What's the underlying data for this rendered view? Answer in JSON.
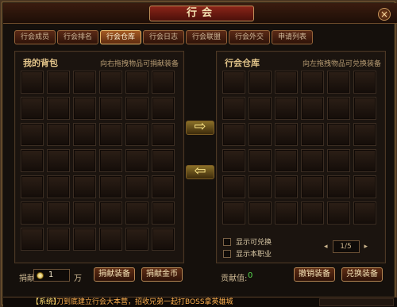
{
  "window": {
    "title": "行会",
    "close_icon": "close-icon"
  },
  "tabs": [
    {
      "label": "行会成员",
      "active": false
    },
    {
      "label": "行会排名",
      "active": false
    },
    {
      "label": "行会仓库",
      "active": true
    },
    {
      "label": "行会日志",
      "active": false
    },
    {
      "label": "行会联盟",
      "active": false
    },
    {
      "label": "行会外交",
      "active": false
    },
    {
      "label": "申请列表",
      "active": false
    }
  ],
  "left_panel": {
    "title": "我的背包",
    "hint": "向右拖拽物品可捐献装备"
  },
  "right_panel": {
    "title": "行会仓库",
    "hint": "向左拖拽物品可兑换装备"
  },
  "transfer": {
    "right_arrow": "⇨",
    "left_arrow": "⇦"
  },
  "filters": [
    {
      "label": "显示可兑换"
    },
    {
      "label": "显示本职业"
    }
  ],
  "pager": {
    "prev": "◂",
    "next": "▸",
    "page": "1/5"
  },
  "bottom_left": {
    "donate_label": "捐献",
    "amount": "1",
    "unit": "万",
    "btn1": "捐献装备",
    "btn2": "捐献金币"
  },
  "bottom_right": {
    "contrib_label": "贡献值:",
    "contrib_value": "0",
    "btn1": "撤销装备",
    "btn2": "兑换装备"
  },
  "chat": {
    "tag": "【系统】",
    "text": "一刀到底建立行会大本营，招收兄弟一起打BOSS拿英雄城"
  }
}
